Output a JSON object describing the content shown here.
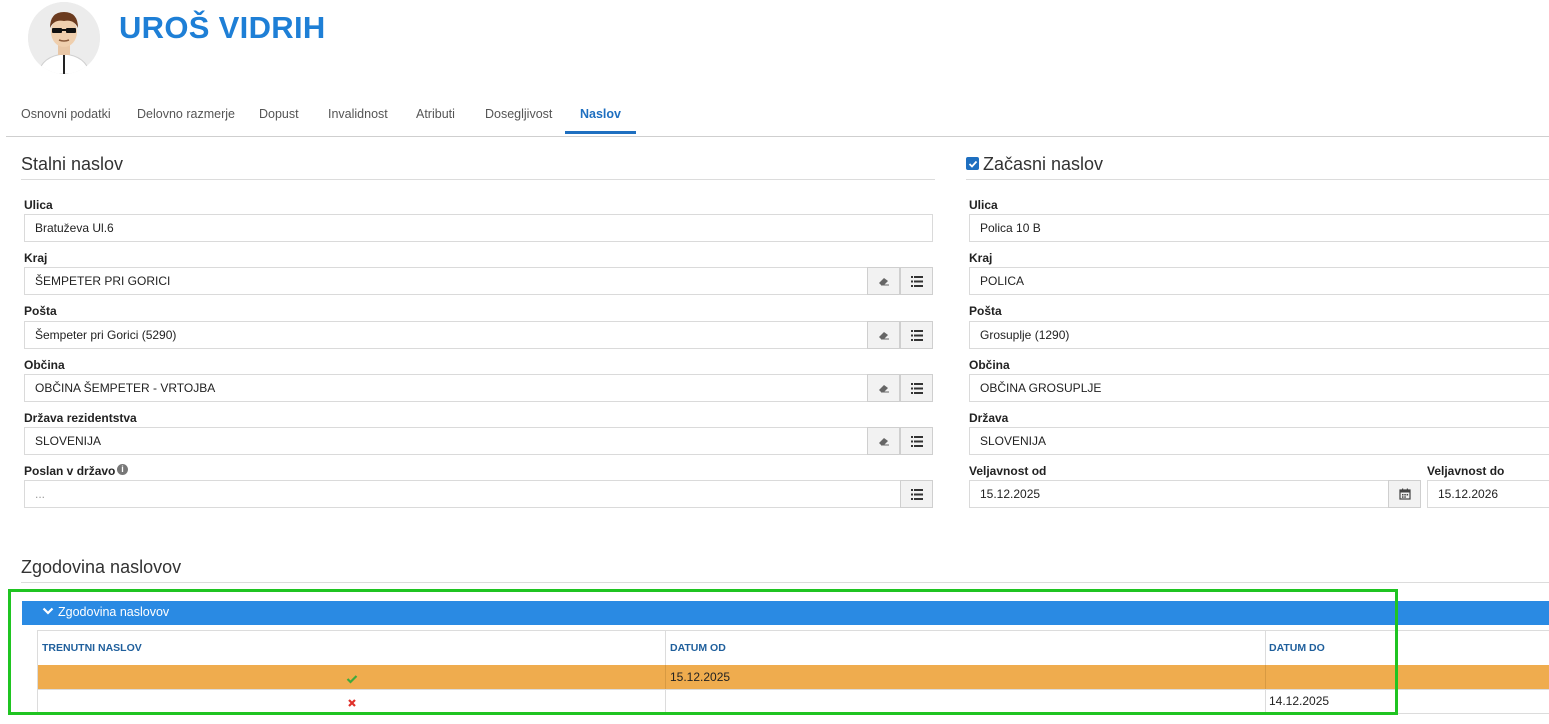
{
  "header": {
    "name": "UROŠ VIDRIH"
  },
  "tabs": [
    {
      "label": "Osnovni podatki"
    },
    {
      "label": "Delovno razmerje"
    },
    {
      "label": "Dopust"
    },
    {
      "label": "Invalidnost"
    },
    {
      "label": "Atributi"
    },
    {
      "label": "Dosegljivost"
    },
    {
      "label": "Naslov",
      "active": true
    }
  ],
  "permanent": {
    "title": "Stalni naslov",
    "street_label": "Ulica",
    "street_value": "Bratuževa Ul.6",
    "region_label": "Kraj",
    "region_value": "ŠEMPETER PRI GORICI",
    "post_label": "Pošta",
    "post_value": "Šempeter pri Gorici (5290)",
    "municipality_label": "Občina",
    "municipality_value": "OBČINA ŠEMPETER - VRTOJBA",
    "country_label": "Država rezidentstva",
    "country_value": "SLOVENIJA",
    "sent_label": "Poslan v državo",
    "sent_placeholder": "..."
  },
  "temporary": {
    "checked": true,
    "title": "Začasni naslov",
    "street_label": "Ulica",
    "street_value": "Polica 10 B",
    "region_label": "Kraj",
    "region_value": "POLICA",
    "post_label": "Pošta",
    "post_value": "Grosuplje (1290)",
    "municipality_label": "Občina",
    "municipality_value": "OBČINA GROSUPLJE",
    "country_label": "Država",
    "country_value": "SLOVENIJA",
    "valid_from_label": "Veljavnost od",
    "valid_from_value": "15.12.2025",
    "valid_to_label": "Veljavnost do",
    "valid_to_value": "15.12.2026"
  },
  "history": {
    "title": "Zgodovina naslovov",
    "panel_label": "Zgodovina naslovov",
    "columns": [
      "TRENUTNI NASLOV",
      "DATUM OD",
      "DATUM DO"
    ],
    "rows": [
      {
        "current": true,
        "from": "15.12.2025",
        "to": ""
      },
      {
        "current": false,
        "from": "",
        "to": "14.12.2025"
      }
    ]
  },
  "colors": {
    "accent": "#1e7fd6",
    "panel_blue": "#2a8ae3",
    "row_highlight": "#efac4e",
    "check_green": "#3daa3d",
    "cross_red": "#e0302a",
    "frame_green": "#1fc421"
  }
}
